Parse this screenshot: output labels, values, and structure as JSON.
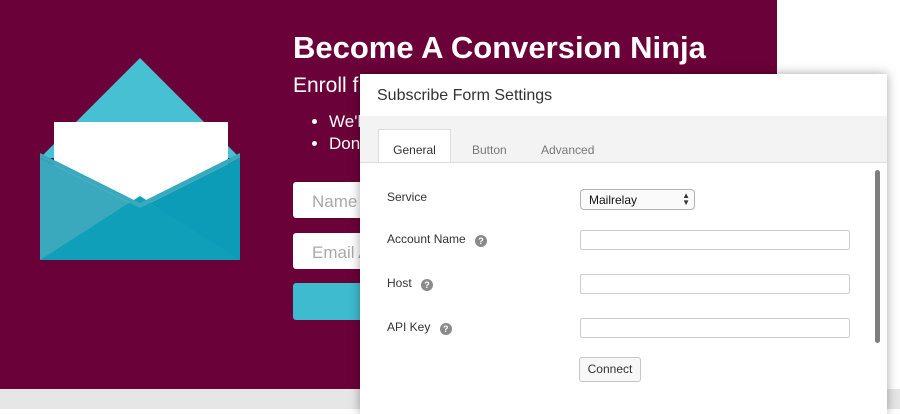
{
  "hero": {
    "title": "Become A Conversion Ninja",
    "subtitle": "Enroll f",
    "bullets": [
      "We'l",
      "Don'"
    ],
    "name_placeholder": "Name",
    "email_placeholder": "Email A"
  },
  "modal": {
    "title": "Subscribe Form Settings",
    "tabs": [
      {
        "label": "General"
      },
      {
        "label": "Button"
      },
      {
        "label": "Advanced"
      }
    ],
    "fields": {
      "service": {
        "label": "Service",
        "value": "Mailrelay"
      },
      "account_name": {
        "label": "Account Name",
        "value": ""
      },
      "host": {
        "label": "Host",
        "value": ""
      },
      "api_key": {
        "label": "API Key",
        "value": ""
      }
    },
    "help_glyph": "?",
    "connect_label": "Connect"
  },
  "colors": {
    "hero_bg": "#6b0139",
    "accent": "#3fbbd0"
  },
  "icons": {
    "envelope": "envelope-icon",
    "help": "question-circle-icon"
  }
}
